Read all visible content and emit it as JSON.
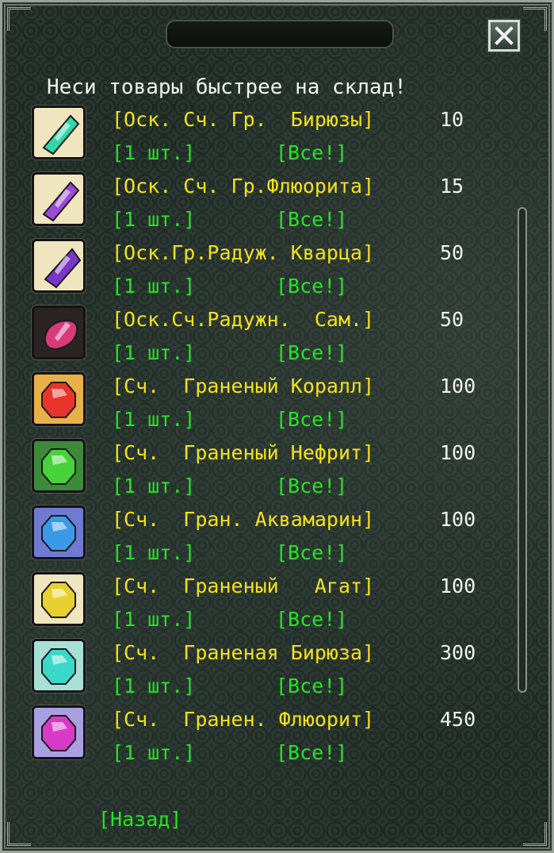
{
  "header": {
    "text": "Неси товары быстрее на склад!"
  },
  "items": [
    {
      "name": "[Оск. Сч. Гр.  Бирюзы]",
      "price": "10",
      "buy_one": "[1 шт.]",
      "buy_all": "[Все!]",
      "icon": "shard-turquoise-icon",
      "color": "#2fd6a8",
      "shape": "shard",
      "bg": "#efe6c0"
    },
    {
      "name": "[Оск. Сч. Гр.Флюорита]",
      "price": "15",
      "buy_one": "[1 шт.]",
      "buy_all": "[Все!]",
      "icon": "shard-fluorite-icon",
      "color": "#9b4ad8",
      "shape": "shard",
      "bg": "#efe6c0"
    },
    {
      "name": "[Оск.Гр.Радуж. Кварца]",
      "price": "50",
      "buy_one": "[1 шт.]",
      "buy_all": "[Все!]",
      "icon": "shard-quartz-icon",
      "color": "#7a35c9",
      "shape": "crystal",
      "bg": "#efe6c0"
    },
    {
      "name": "[Оск.Сч.Радужн.  Сам.]",
      "price": "50",
      "buy_one": "[1 шт.]",
      "buy_all": "[Все!]",
      "icon": "shard-sapphire-icon",
      "color": "#d83a7a",
      "shape": "pebble",
      "bg": "#2a2424"
    },
    {
      "name": "[Сч.  Граненый Коралл]",
      "price": "100",
      "buy_one": "[1 шт.]",
      "buy_all": "[Все!]",
      "icon": "gem-coral-icon",
      "color": "#e8342a",
      "shape": "gem",
      "bg": "#e8b048"
    },
    {
      "name": "[Сч.  Граненый Нефрит]",
      "price": "100",
      "buy_one": "[1 шт.]",
      "buy_all": "[Все!]",
      "icon": "gem-jade-icon",
      "color": "#48d23a",
      "shape": "gem",
      "bg": "#3d8a3a"
    },
    {
      "name": "[Сч.  Гран. Аквамарин]",
      "price": "100",
      "buy_one": "[1 шт.]",
      "buy_all": "[Все!]",
      "icon": "gem-aquamarine-icon",
      "color": "#3a9ae8",
      "shape": "gem",
      "bg": "#6f7bd0"
    },
    {
      "name": "[Сч.  Граненый   Агат]",
      "price": "100",
      "buy_one": "[1 шт.]",
      "buy_all": "[Все!]",
      "icon": "gem-agate-icon",
      "color": "#e8d030",
      "shape": "gem",
      "bg": "#efe6c0"
    },
    {
      "name": "[Сч.  Граненая Бирюза]",
      "price": "300",
      "buy_one": "[1 шт.]",
      "buy_all": "[Все!]",
      "icon": "gem-turquoise-icon",
      "color": "#3ad8c8",
      "shape": "gem",
      "bg": "#a8e0d8"
    },
    {
      "name": "[Сч.  Гранен. Флюорит]",
      "price": "450",
      "buy_one": "[1 шт.]",
      "buy_all": "[Все!]",
      "icon": "gem-fluorite-icon",
      "color": "#d83ac8",
      "shape": "gem",
      "bg": "#a8a0e0"
    }
  ],
  "footer": {
    "back_label": "[Назад]"
  },
  "colors": {
    "item_name": "#f2e21d",
    "action": "#27e327",
    "text": "#f2f2f2"
  }
}
